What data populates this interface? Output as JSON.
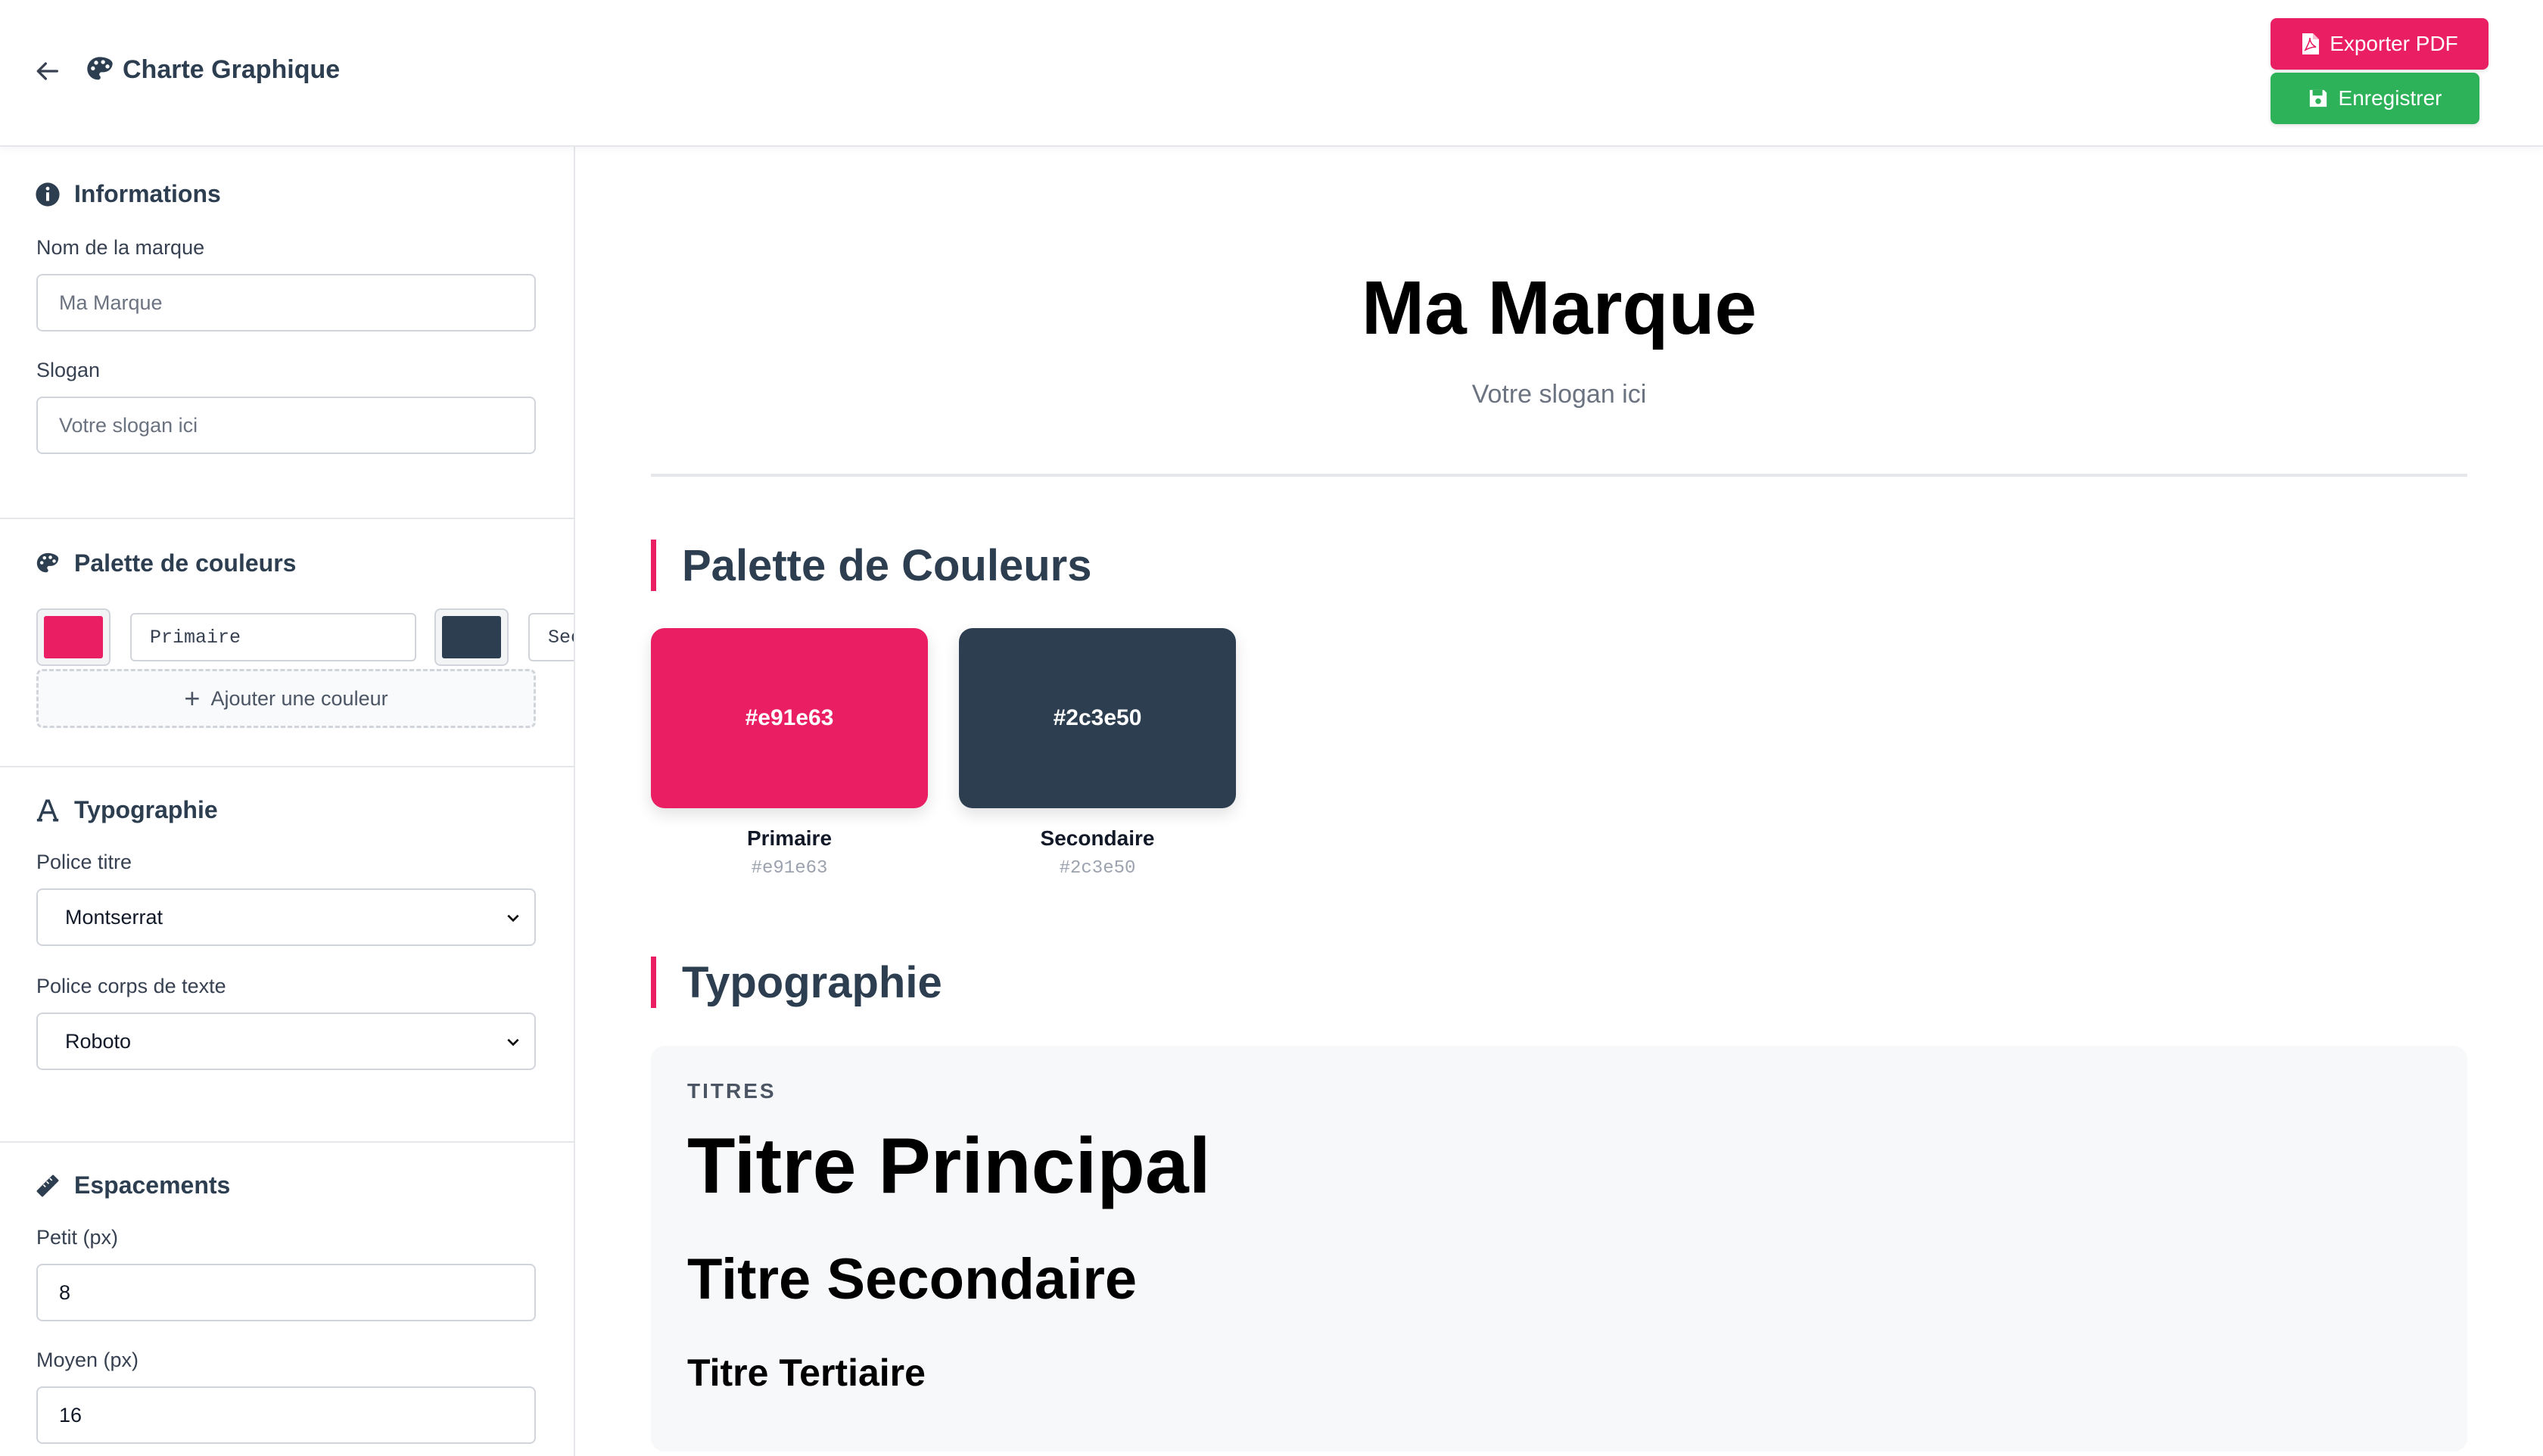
{
  "header": {
    "title": "Charte Graphique",
    "export_pdf_label": "Exporter PDF",
    "save_label": "Enregistrer"
  },
  "sidebar": {
    "informations": {
      "title": "Informations",
      "brand_name_label": "Nom de la marque",
      "brand_name_placeholder": "Ma Marque",
      "slogan_label": "Slogan",
      "slogan_placeholder": "Votre slogan ici"
    },
    "palette": {
      "title": "Palette de couleurs",
      "colors": [
        {
          "name": "Primaire",
          "hex": "#e91e63"
        },
        {
          "name": "Secondaire",
          "hex": "#2c3e50"
        }
      ],
      "add_label": "Ajouter une couleur"
    },
    "typography": {
      "title": "Typographie",
      "heading_font_label": "Police titre",
      "heading_font_value": "Montserrat",
      "body_font_label": "Police corps de texte",
      "body_font_value": "Roboto"
    },
    "spacing": {
      "title": "Espacements",
      "small_label": "Petit (px)",
      "small_value": "8",
      "medium_label": "Moyen (px)",
      "medium_value": "16"
    }
  },
  "preview": {
    "brand_name": "Ma Marque",
    "slogan": "Votre slogan ici",
    "palette_title": "Palette de Couleurs",
    "colors": [
      {
        "name": "Primaire",
        "hex": "#e91e63"
      },
      {
        "name": "Secondaire",
        "hex": "#2c3e50"
      }
    ],
    "typography_title": "Typographie",
    "titles_label": "TITRES",
    "title_primary": "Titre Principal",
    "title_secondary": "Titre Secondaire",
    "title_tertiary": "Titre Tertiaire"
  },
  "theme": {
    "accent": "#e91e63",
    "save_green": "#2db25a",
    "dark": "#2c3e50"
  }
}
